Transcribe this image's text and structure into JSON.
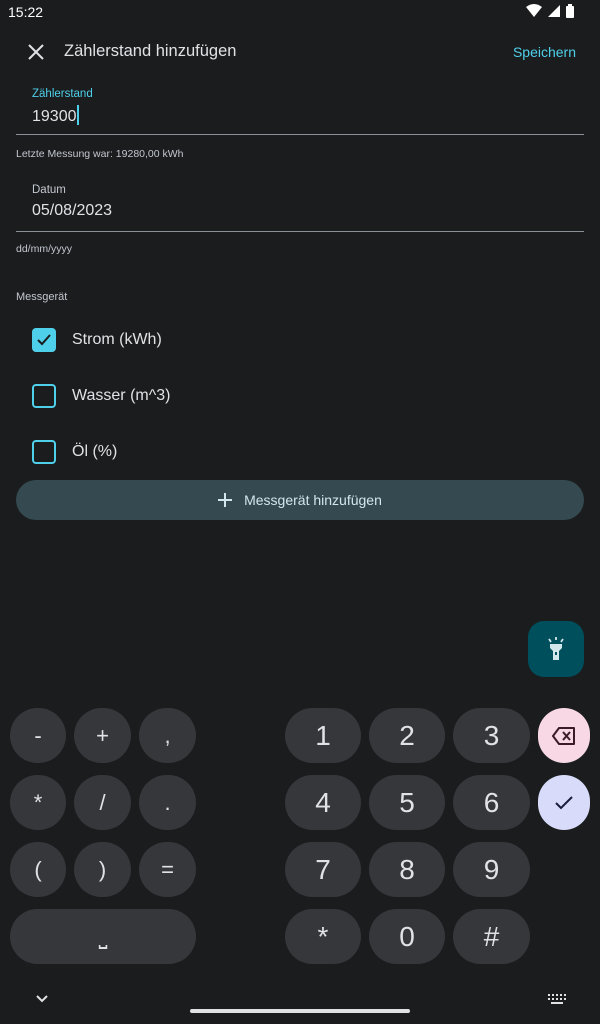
{
  "status_bar": {
    "time": "15:22"
  },
  "app_bar": {
    "title": "Zählerstand hinzufügen",
    "save_label": "Speichern"
  },
  "reading_field": {
    "label": "Zählerstand",
    "value": "19300",
    "helper": "Letzte Messung war: 19280,00 kWh"
  },
  "date_field": {
    "label": "Datum",
    "value": "05/08/2023",
    "helper": "dd/mm/yyyy"
  },
  "devices": {
    "label": "Messgerät",
    "items": [
      {
        "label": "Strom (kWh)",
        "checked": true
      },
      {
        "label": "Wasser (m^3)",
        "checked": false
      },
      {
        "label": "Öl (%)",
        "checked": false
      }
    ],
    "add_label": "Messgerät hinzufügen"
  },
  "colors": {
    "accent": "#4fd0ea",
    "background": "#1a1c1e",
    "key": "#35373b"
  },
  "keyboard": {
    "symbols": [
      "-",
      "+",
      ",",
      "*",
      "/",
      ".",
      "(",
      ")",
      "="
    ],
    "digits": [
      "1",
      "2",
      "3",
      "4",
      "5",
      "6",
      "7",
      "8",
      "9",
      "*",
      "0",
      "#"
    ],
    "space": "⎵"
  }
}
